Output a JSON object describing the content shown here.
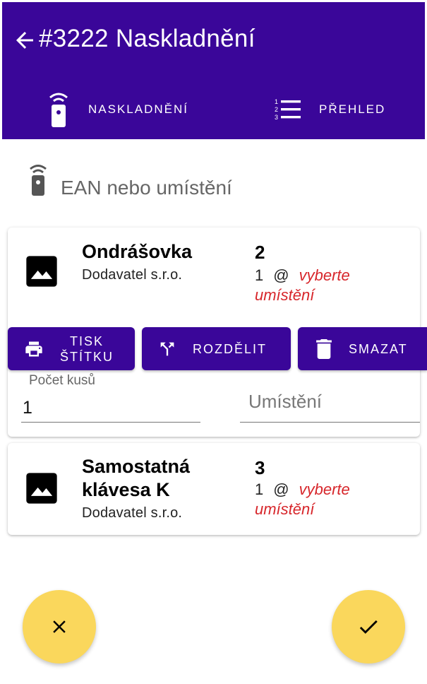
{
  "header": {
    "title": "#3222 Naskladnění",
    "back_icon": "arrow-left-icon",
    "background": "#3a0699"
  },
  "tabs": [
    {
      "label": "NASKLADNĚNÍ",
      "icon": "scanner-remote-icon"
    },
    {
      "label": "PŘEHLED",
      "icon": "numbered-list-icon"
    }
  ],
  "search": {
    "placeholder": "EAN nebo umístění",
    "icon": "scanner-remote-icon"
  },
  "items": [
    {
      "name": "Ondrášovka",
      "supplier": "Dodavatel s.r.o.",
      "quantity": "2",
      "alloc_count": "1",
      "alloc_at": "@",
      "alloc_location": "vyberte umístění"
    },
    {
      "name": "Samostatná klávesa K",
      "supplier": "Dodavatel s.r.o.",
      "quantity": "3",
      "alloc_count": "1",
      "alloc_at": "@",
      "alloc_location": "vyberte umístění"
    }
  ],
  "actions": {
    "print_label": "TISK ŠTÍTKU",
    "split_label": "ROZDĚLIT",
    "delete_label": "SMAZAT"
  },
  "fields": {
    "count_label": "Počet kusů",
    "count_value": "1",
    "location_placeholder": "Umístění"
  },
  "fabs": {
    "cancel_icon": "close-icon",
    "confirm_icon": "check-icon",
    "color": "#fad75c"
  },
  "colors": {
    "primary": "#3a0699",
    "warning_text": "#d7262b"
  }
}
